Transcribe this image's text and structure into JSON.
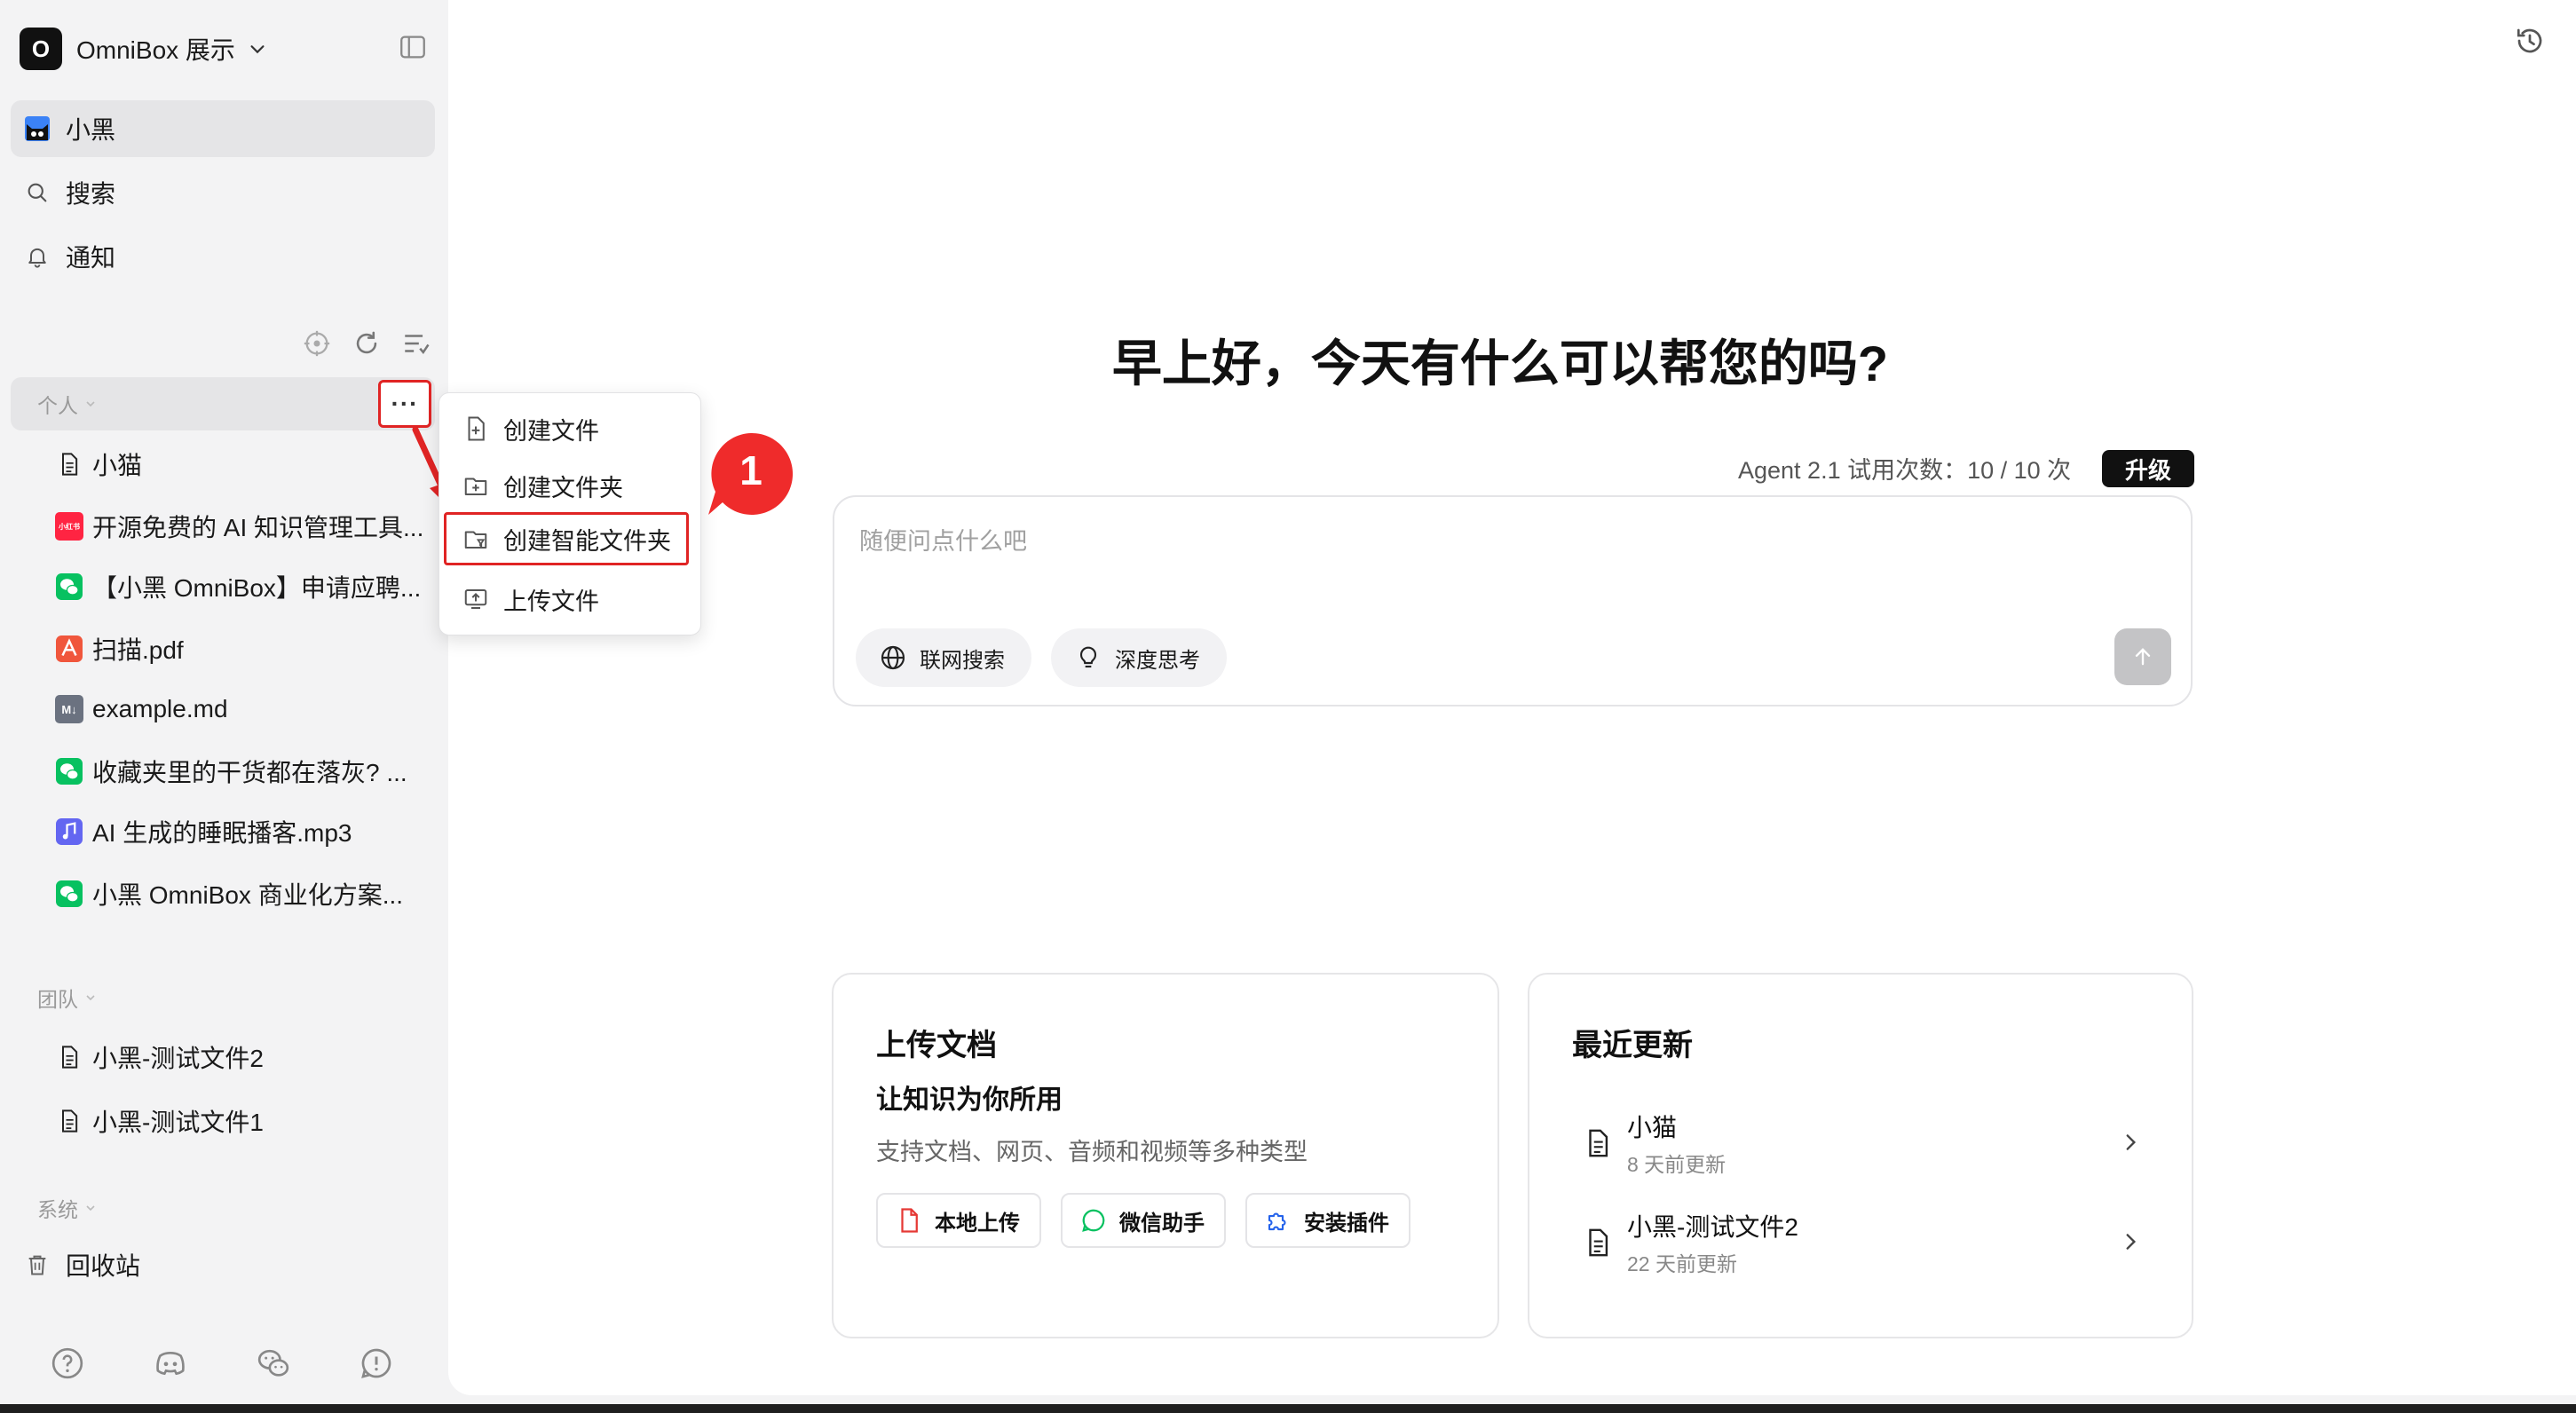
{
  "workspace": {
    "avatar_letter": "O",
    "name": "OmniBox 展示"
  },
  "nav": {
    "user": "小黑",
    "search": "搜索",
    "notifications": "通知"
  },
  "sections": {
    "personal": "个人",
    "team": "团队",
    "system": "系统"
  },
  "personal_files": [
    {
      "name": "小猫",
      "icon": "doc-icon"
    },
    {
      "name": "开源免费的 AI 知识管理工具...",
      "icon": "xiaohongshu-icon",
      "badge": "小红书"
    },
    {
      "name": "【小黑 OmniBox】申请应聘...",
      "icon": "wechat-icon"
    },
    {
      "name": "扫描.pdf",
      "icon": "pdf-icon"
    },
    {
      "name": "example.md",
      "icon": "markdown-icon",
      "badge": "M↓"
    },
    {
      "name": "收藏夹里的干货都在落灰? ...",
      "icon": "wechat-icon"
    },
    {
      "name": "AI 生成的睡眠播客.mp3",
      "icon": "audio-icon"
    },
    {
      "name": "小黑 OmniBox 商业化方案...",
      "icon": "wechat-icon"
    }
  ],
  "team_files": [
    {
      "name": "小黑-测试文件2"
    },
    {
      "name": "小黑-测试文件1"
    }
  ],
  "trash": "回收站",
  "more_button": "···",
  "menu": {
    "create_file": "创建文件",
    "create_folder": "创建文件夹",
    "create_smart_folder": "创建智能文件夹",
    "upload_file": "上传文件"
  },
  "step_badge": "1",
  "main": {
    "greeting": "早上好，今天有什么可以帮您的吗?",
    "quota": "Agent 2.1 试用次数：10 / 10 次",
    "upgrade": "升级",
    "chat_placeholder": "随便问点什么吧",
    "web_search": "联网搜索",
    "deep_think": "深度思考"
  },
  "upload_card": {
    "title": "上传文档",
    "subtitle": "让知识为你所用",
    "desc": "支持文档、网页、音频和视频等多种类型",
    "local_upload": "本地上传",
    "wechat_assistant": "微信助手",
    "install_plugin": "安装插件"
  },
  "recent_card": {
    "title": "最近更新",
    "items": [
      {
        "name": "小猫",
        "time": "8 天前更新"
      },
      {
        "name": "小黑-测试文件2",
        "time": "22 天前更新"
      }
    ]
  },
  "colors": {
    "accent_red": "#e02424",
    "xiaohongshu": "#ff2442",
    "wechat": "#07c160",
    "pdf": "#f0563c",
    "audio": "#6366f1",
    "markdown": "#6b7280"
  }
}
